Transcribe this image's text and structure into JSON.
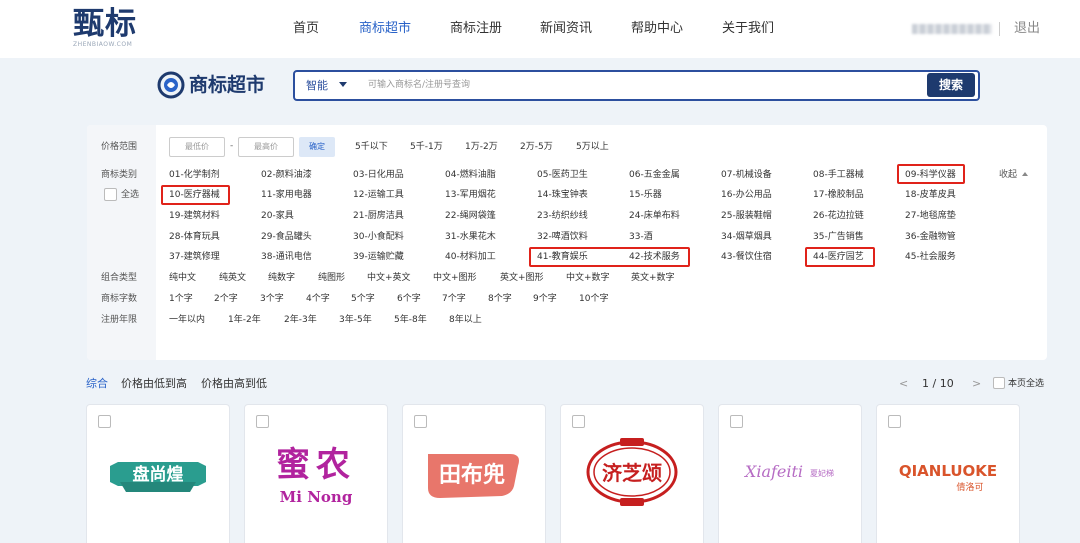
{
  "header": {
    "logo_text": "甄标",
    "logo_sub": "ZHENBIAOW.COM",
    "nav": [
      "首页",
      "商标超市",
      "商标注册",
      "新闻资讯",
      "帮助中心",
      "关于我们"
    ],
    "logout": "退出"
  },
  "search": {
    "brand_title": "商标超市",
    "type_label": "智能",
    "placeholder": "可输入商标名/注册号查询",
    "button": "搜索"
  },
  "filters": {
    "price_label": "价格范围",
    "min_placeholder": "最低价",
    "dash": "-",
    "max_placeholder": "最高价",
    "confirm": "确定",
    "price_ranges": [
      "5千以下",
      "5千-1万",
      "1万-2万",
      "2万-5万",
      "5万以上"
    ],
    "category_label": "商标类别",
    "select_all": "全选",
    "collapse": "收起",
    "categories": [
      "01-化学制剂",
      "02-颜料油漆",
      "03-日化用品",
      "04-燃料油脂",
      "05-医药卫生",
      "06-五金金属",
      "07-机械设备",
      "08-手工器械",
      "09-科学仪器",
      "10-医疗器械",
      "11-家用电器",
      "12-运输工具",
      "13-军用烟花",
      "14-珠宝钟表",
      "15-乐器",
      "16-办公用品",
      "17-橡胶制品",
      "18-皮革皮具",
      "19-建筑材料",
      "20-家具",
      "21-厨房洁具",
      "22-绳网袋篷",
      "23-纺织纱线",
      "24-床单布料",
      "25-服装鞋帽",
      "26-花边拉链",
      "27-地毯席垫",
      "28-体育玩具",
      "29-食品罐头",
      "30-小食配料",
      "31-水果花木",
      "32-啤酒饮料",
      "33-酒",
      "34-烟草烟具",
      "35-广告销售",
      "36-金融物管",
      "37-建筑修理",
      "38-通讯电信",
      "39-运输贮藏",
      "40-材料加工",
      "41-教育娱乐",
      "42-技术服务",
      "43-餐饮住宿",
      "44-医疗园艺",
      "45-社会服务"
    ],
    "combo_label": "组合类型",
    "combos": [
      "纯中文",
      "纯英文",
      "纯数字",
      "纯图形",
      "中文+英文",
      "中文+图形",
      "英文+图形",
      "中文+数字",
      "英文+数字"
    ],
    "count_label": "商标字数",
    "counts": [
      "1个字",
      "2个字",
      "3个字",
      "4个字",
      "5个字",
      "6个字",
      "7个字",
      "8个字",
      "9个字",
      "10个字"
    ],
    "years_label": "注册年限",
    "years": [
      "一年以内",
      "1年-2年",
      "2年-3年",
      "3年-5年",
      "5年-8年",
      "8年以上"
    ]
  },
  "sort": {
    "items": [
      "综合",
      "价格由低到高",
      "价格由高到低"
    ],
    "prev": "<",
    "page": "1 / 10",
    "next": ">",
    "select_page": "本页全选"
  },
  "cards": [
    {
      "name": "盘尚煌"
    },
    {
      "name": "蜜农",
      "sub": "Mi Nong"
    },
    {
      "name": "田布兜"
    },
    {
      "name": "济芝颂"
    },
    {
      "name": "Xiafeiti",
      "sub": "夏妃梯"
    },
    {
      "name": "QIANLUOKE",
      "sub": "倩洛可"
    }
  ],
  "colors": {
    "brand": "#1e3a6e",
    "accent": "#2a63c8",
    "highlight": "#e0231a"
  }
}
